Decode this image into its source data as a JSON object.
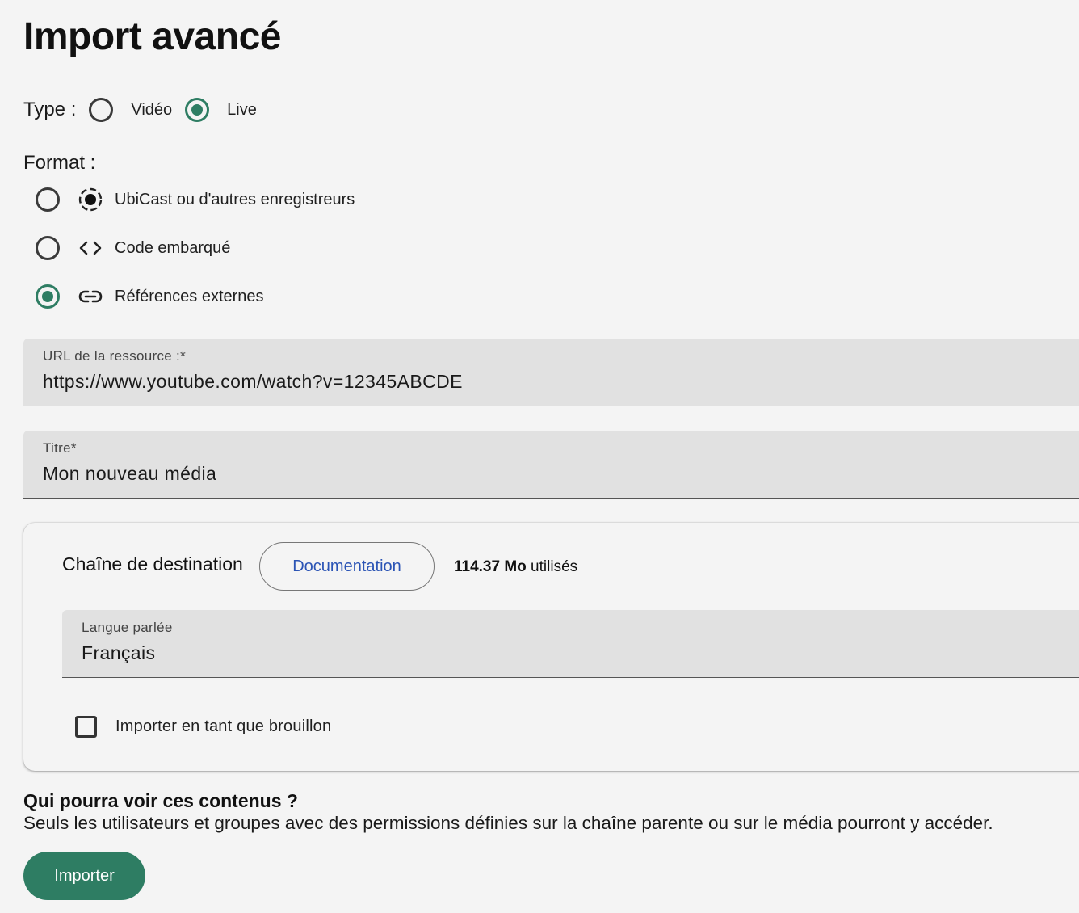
{
  "page": {
    "title": "Import avancé"
  },
  "type": {
    "label": "Type :",
    "options": [
      {
        "label": "Vidéo",
        "selected": false
      },
      {
        "label": "Live",
        "selected": true
      }
    ]
  },
  "format": {
    "label": "Format :",
    "options": [
      {
        "label": "UbiCast ou d'autres enregistreurs",
        "icon": "record-icon",
        "selected": false
      },
      {
        "label": "Code embarqué",
        "icon": "code-icon",
        "selected": false
      },
      {
        "label": "Références externes",
        "icon": "link-icon",
        "selected": true
      }
    ]
  },
  "url_field": {
    "label": "URL de la ressource :*",
    "value": "https://www.youtube.com/watch?v=12345ABCDE"
  },
  "title_field": {
    "label": "Titre*",
    "value": "Mon nouveau média"
  },
  "destination": {
    "label": "Chaîne de destination",
    "doc_button": "Documentation",
    "usage_value": "114.37 Mo",
    "usage_suffix": " utilisés"
  },
  "language_field": {
    "label": "Langue parlée",
    "value": "Français"
  },
  "draft": {
    "label": "Importer en tant que brouillon",
    "checked": false
  },
  "visibility": {
    "title": "Qui pourra voir ces contenus ?",
    "text": "Seuls les utilisateurs et groupes avec des permissions définies sur la chaîne parente ou sur le média pourront y accéder."
  },
  "import_button": "Importer",
  "colors": {
    "accent": "#2e7d63",
    "link": "#2b54b5",
    "field_bg": "#e1e1e1",
    "page_bg": "#f4f4f4"
  }
}
